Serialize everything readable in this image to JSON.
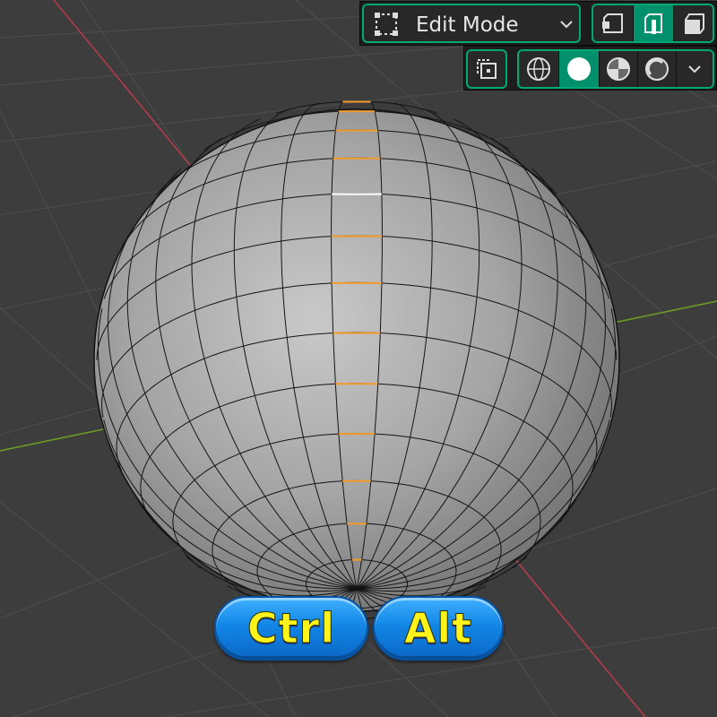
{
  "viewport": {
    "mode_selector": {
      "label": "Edit Mode",
      "icon": "edit-mode-icon",
      "dropdown_icon": "chevron-down-icon"
    },
    "select_modes": {
      "items": [
        {
          "name": "vertex-select",
          "active": false
        },
        {
          "name": "edge-select",
          "active": true
        },
        {
          "name": "face-select",
          "active": false
        }
      ]
    },
    "overlay": {
      "icon": "xray-toggle-icon"
    },
    "shading": {
      "items": [
        {
          "name": "wireframe",
          "active": false
        },
        {
          "name": "solid",
          "active": true
        },
        {
          "name": "material-preview",
          "active": false
        },
        {
          "name": "rendered",
          "active": false
        }
      ],
      "dropdown_icon": "chevron-down-icon"
    },
    "colors": {
      "accent": "#00906c",
      "selected_edge": "#f39a2b",
      "x_axis": "#b33c49",
      "y_axis": "#6a9b24",
      "grid": "#4b4b4b"
    }
  },
  "key_overlay": {
    "ctrl": "Ctrl",
    "alt": "Alt"
  }
}
